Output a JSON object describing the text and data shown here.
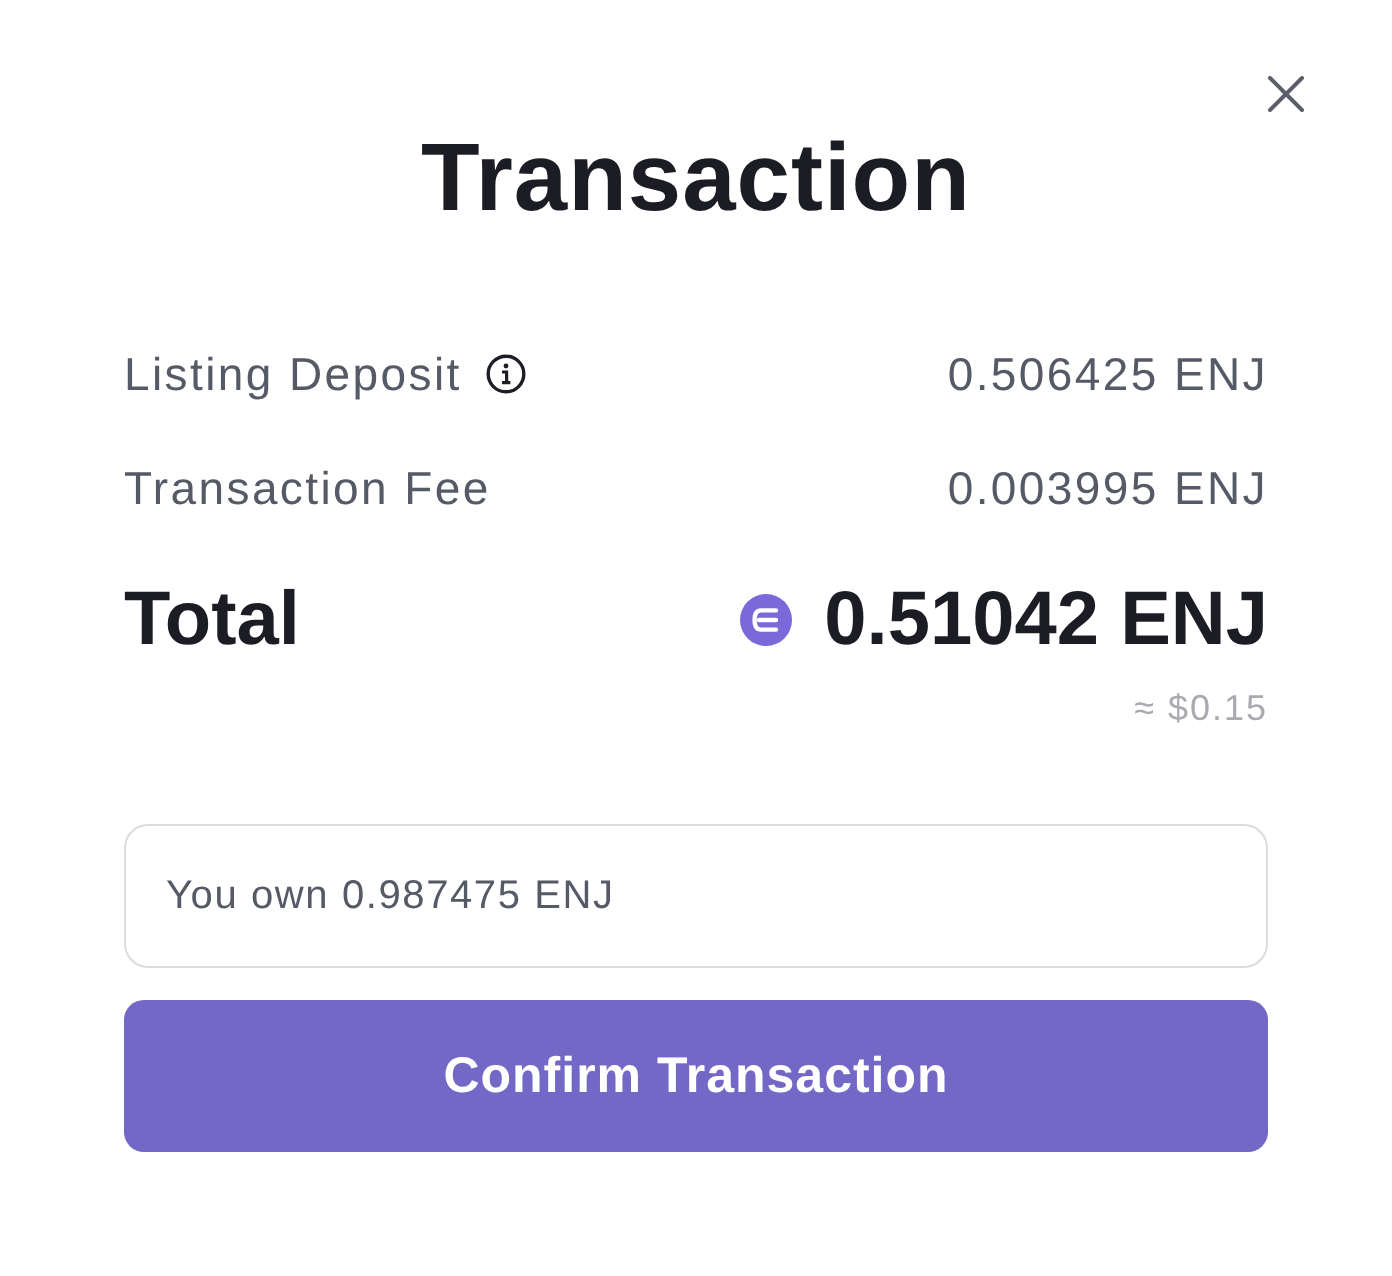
{
  "dialog": {
    "title": "Transaction"
  },
  "line_items": [
    {
      "label": "Listing Deposit",
      "info": true,
      "value": "0.506425 ENJ"
    },
    {
      "label": "Transaction Fee",
      "info": false,
      "value": "0.003995 ENJ"
    }
  ],
  "total": {
    "label": "Total",
    "value": "0.51042 ENJ",
    "fiat": "≈ $0.15"
  },
  "balance": "You own 0.987475 ENJ",
  "confirm_button": "Confirm Transaction"
}
